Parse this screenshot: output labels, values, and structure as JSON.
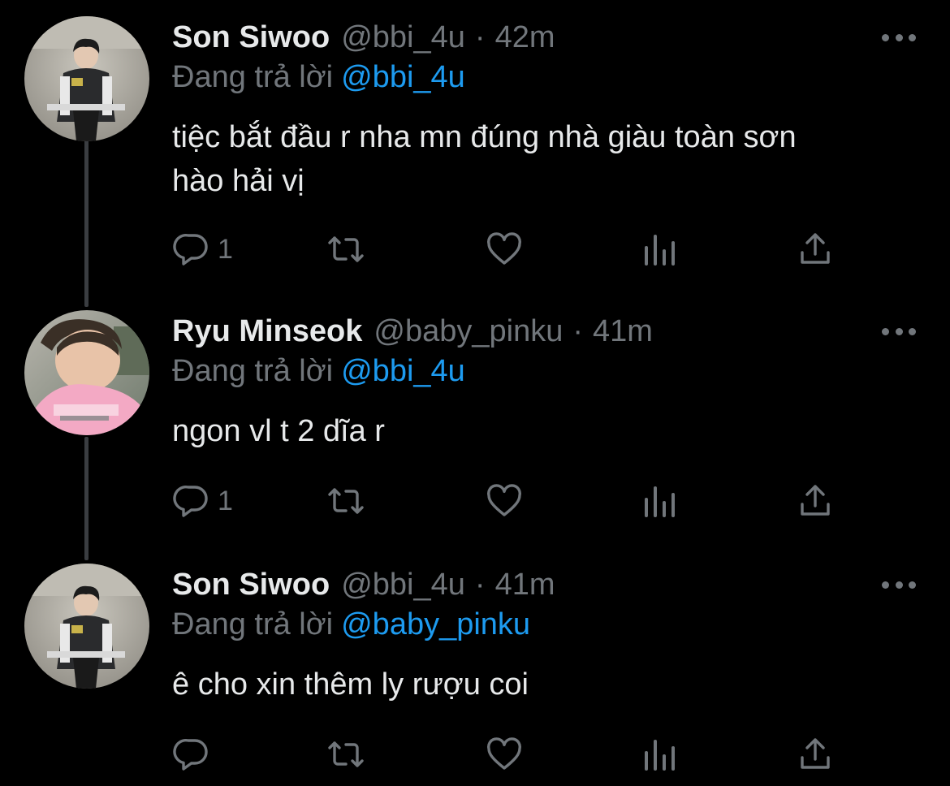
{
  "tweets": [
    {
      "name": "Son Siwoo",
      "handle": "@bbi_4u",
      "separator": "·",
      "time": "42m",
      "replying_label": "Đang trả lời",
      "replying_to": "@bbi_4u",
      "text": "tiệc bắt đầu r nha mn đúng nhà giàu toàn sơn\nhào hải vị",
      "reply_count": "1",
      "avatar": "son-siwoo-avatar"
    },
    {
      "name": "Ryu Minseok",
      "handle": "@baby_pinku",
      "separator": "·",
      "time": "41m",
      "replying_label": "Đang trả lời",
      "replying_to": "@bbi_4u",
      "text": "ngon vl t 2 dĩa r",
      "reply_count": "1",
      "avatar": "ryu-minseok-avatar"
    },
    {
      "name": "Son Siwoo",
      "handle": "@bbi_4u",
      "separator": "·",
      "time": "41m",
      "replying_label": "Đang trả lời",
      "replying_to": "@baby_pinku",
      "text": "ê cho xin thêm ly rượu coi",
      "reply_count": "",
      "avatar": "son-siwoo-avatar"
    }
  ],
  "icons": {
    "reply": "reply-icon",
    "retweet": "retweet-icon",
    "like": "heart-icon",
    "views": "analytics-icon",
    "share": "share-icon",
    "more": "more-icon"
  },
  "colors": {
    "background": "#000000",
    "text": "#e7e9ea",
    "secondary": "#71767b",
    "link": "#1d9bf0",
    "thread_line": "#3a3d41"
  }
}
